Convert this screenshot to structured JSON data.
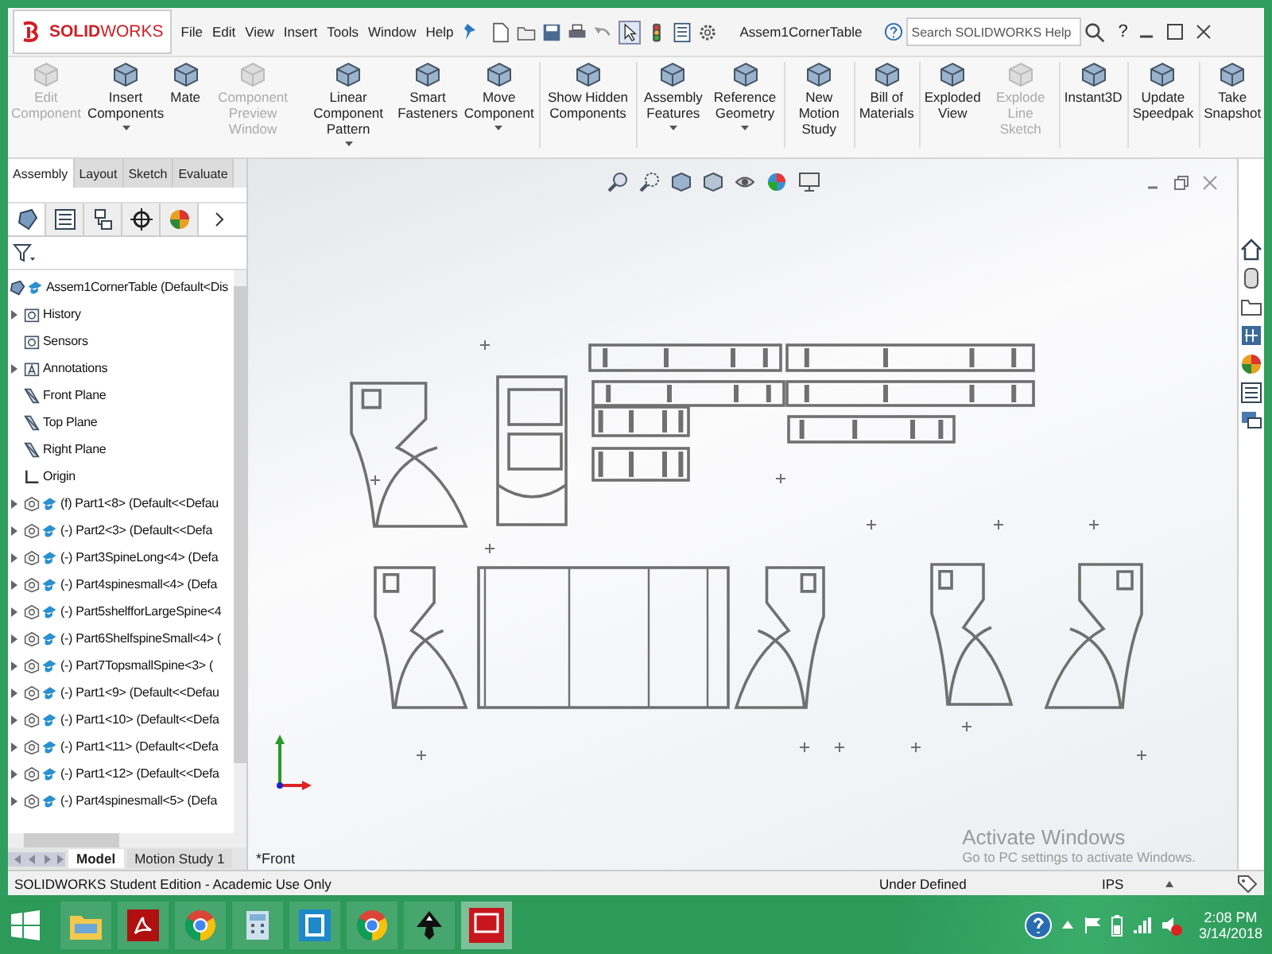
{
  "app": {
    "logo": "**SOLID**WORKS"
  },
  "menu": [
    "File",
    "Edit",
    "View",
    "Insert",
    "Tools",
    "Window",
    "Help"
  ],
  "document_title": "Assem1CornerTable",
  "search": {
    "placeholder": "Search SOLIDWORKS Help"
  },
  "help_symbol": "?",
  "ribbon": [
    {
      "label": "Edit Component",
      "disabled": true,
      "dropdown": false,
      "group_end": false
    },
    {
      "label": "Insert Components",
      "disabled": false,
      "dropdown": true,
      "group_end": false
    },
    {
      "label": "Mate",
      "disabled": false,
      "dropdown": false,
      "group_end": false
    },
    {
      "label": "Component Preview Window",
      "disabled": true,
      "dropdown": false,
      "group_end": false
    },
    {
      "label": "Linear Component Pattern",
      "disabled": false,
      "dropdown": true,
      "group_end": false
    },
    {
      "label": "Smart Fasteners",
      "disabled": false,
      "dropdown": false,
      "group_end": false
    },
    {
      "label": "Move Component",
      "disabled": false,
      "dropdown": true,
      "group_end": true
    },
    {
      "label": "Show Hidden Components",
      "disabled": false,
      "dropdown": false,
      "group_end": true
    },
    {
      "label": "Assembly Features",
      "disabled": false,
      "dropdown": true,
      "group_end": false
    },
    {
      "label": "Reference Geometry",
      "disabled": false,
      "dropdown": true,
      "group_end": true
    },
    {
      "label": "New Motion Study",
      "disabled": false,
      "dropdown": false,
      "group_end": true
    },
    {
      "label": "Bill of Materials",
      "disabled": false,
      "dropdown": false,
      "group_end": true
    },
    {
      "label": "Exploded View",
      "disabled": false,
      "dropdown": false,
      "group_end": false
    },
    {
      "label": "Explode Line Sketch",
      "disabled": true,
      "dropdown": false,
      "group_end": true
    },
    {
      "label": "Instant3D",
      "disabled": false,
      "dropdown": false,
      "group_end": true
    },
    {
      "label": "Update Speedpak",
      "disabled": false,
      "dropdown": false,
      "group_end": true
    },
    {
      "label": "Take Snapshot",
      "disabled": false,
      "dropdown": false,
      "group_end": false
    }
  ],
  "command_tabs": [
    {
      "label": "Assembly",
      "selected": true
    },
    {
      "label": "Layout",
      "selected": false
    },
    {
      "label": "Sketch",
      "selected": false
    },
    {
      "label": "Evaluate",
      "selected": false
    }
  ],
  "panel_tabs": [
    {
      "kind": "tree",
      "selected": true
    },
    {
      "kind": "properties",
      "selected": false
    },
    {
      "kind": "config",
      "selected": false
    },
    {
      "kind": "crosshair",
      "selected": false
    },
    {
      "kind": "sphere",
      "selected": false
    }
  ],
  "tree": {
    "root": "Assem1CornerTable  (Default<Dis",
    "items": [
      {
        "label": "History",
        "kind": "history",
        "expandable": true
      },
      {
        "label": "Sensors",
        "kind": "sensors",
        "expandable": false
      },
      {
        "label": "Annotations",
        "kind": "annotations",
        "expandable": true
      },
      {
        "label": "Front Plane",
        "kind": "plane",
        "expandable": false
      },
      {
        "label": "Top Plane",
        "kind": "plane",
        "expandable": false
      },
      {
        "label": "Right Plane",
        "kind": "plane",
        "expandable": false
      },
      {
        "label": "Origin",
        "kind": "origin",
        "expandable": false
      },
      {
        "label": "(f) Part1<8> (Default<<Defau",
        "kind": "part",
        "expandable": true
      },
      {
        "label": "(-) Part2<3> (Default<<Defa",
        "kind": "part",
        "expandable": true
      },
      {
        "label": "(-) Part3SpineLong<4> (Defa",
        "kind": "part",
        "expandable": true
      },
      {
        "label": "(-) Part4spinesmall<4> (Defa",
        "kind": "part",
        "expandable": true
      },
      {
        "label": "(-) Part5shelfforLargeSpine<4",
        "kind": "part",
        "expandable": true
      },
      {
        "label": "(-) Part6ShelfspineSmall<4> (",
        "kind": "part",
        "expandable": true
      },
      {
        "label": "(-) Part7TopsmallSpine<3> (",
        "kind": "part",
        "expandable": true
      },
      {
        "label": "(-) Part1<9> (Default<<Defau",
        "kind": "part",
        "expandable": true
      },
      {
        "label": "(-) Part1<10> (Default<<Defa",
        "kind": "part",
        "expandable": true
      },
      {
        "label": "(-) Part1<11> (Default<<Defa",
        "kind": "part",
        "expandable": true
      },
      {
        "label": "(-) Part1<12> (Default<<Defa",
        "kind": "part",
        "expandable": true
      },
      {
        "label": "(-) Part4spinesmall<5> (Defa",
        "kind": "part",
        "expandable": true
      }
    ]
  },
  "model_tabs": [
    {
      "label": "Model",
      "selected": true
    },
    {
      "label": "Motion Study 1",
      "selected": false
    }
  ],
  "view_name": "*Front",
  "activation": {
    "title": "Activate Windows",
    "subtitle": "Go to PC settings to activate Windows."
  },
  "status_bar": {
    "edition": "SOLIDWORKS Student Edition - Academic Use Only",
    "sketch_state": "Under Defined",
    "units": "IPS"
  },
  "taskbar": {
    "apps": [
      {
        "kind": "files",
        "selected": false
      },
      {
        "kind": "pdf",
        "selected": false
      },
      {
        "kind": "browser",
        "selected": false
      },
      {
        "kind": "calculator",
        "selected": false
      },
      {
        "kind": "bracket",
        "selected": false
      },
      {
        "kind": "browser",
        "selected": false
      },
      {
        "kind": "ink",
        "selected": false
      },
      {
        "kind": "cad",
        "selected": true
      }
    ],
    "time": "2:08 PM",
    "date": "3/14/2018"
  }
}
